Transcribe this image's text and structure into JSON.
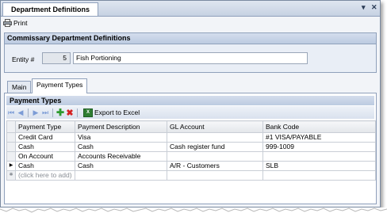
{
  "window": {
    "title": "Department Definitions",
    "pin": "▾",
    "close": "✕"
  },
  "toolbar": {
    "print_label": "Print"
  },
  "section": {
    "title": "Commissary Department Definitions"
  },
  "entity": {
    "label": "Entity #",
    "number": "5",
    "name": "Fish Portioning"
  },
  "tabs": [
    {
      "label": "Main"
    },
    {
      "label": "Payment Types"
    }
  ],
  "payments": {
    "title": "Payment Types",
    "export_label": "Export to Excel",
    "columns": [
      "Payment Type",
      "Payment Description",
      "GL Account",
      "Bank Code"
    ],
    "rows": [
      [
        "Credit Card",
        "Visa",
        "",
        "#1 VISA/PAYABLE"
      ],
      [
        "Cash",
        "Cash",
        "Cash register fund",
        "999-1009"
      ],
      [
        "On Account",
        "Accounts Receivable",
        "",
        ""
      ],
      [
        "Cash",
        "Cash",
        "A/R - Customers",
        "SLB"
      ]
    ],
    "new_row_hint": "(click here to add)"
  }
}
